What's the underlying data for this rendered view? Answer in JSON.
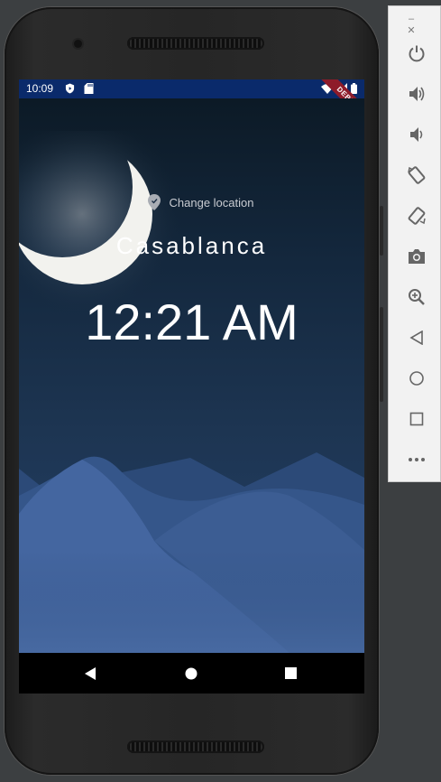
{
  "status_bar": {
    "time": "10:09",
    "debug_banner": "DEBUG"
  },
  "app": {
    "change_location_label": "Change location",
    "city": "Casablanca",
    "time": "12:21 AM"
  },
  "colors": {
    "status_bar": "#0a2a6b",
    "sky_top": "#0c1a26",
    "sky_bottom": "#25416a",
    "mountain": "#46679d",
    "debug_ribbon": "#8e1b2a"
  },
  "emulator_toolbar": {
    "icons": [
      "power-icon",
      "volume-up-icon",
      "volume-down-icon",
      "rotate-left-icon",
      "rotate-right-icon",
      "camera-icon",
      "zoom-icon",
      "back-icon",
      "home-icon",
      "overview-icon",
      "more-icon"
    ]
  }
}
